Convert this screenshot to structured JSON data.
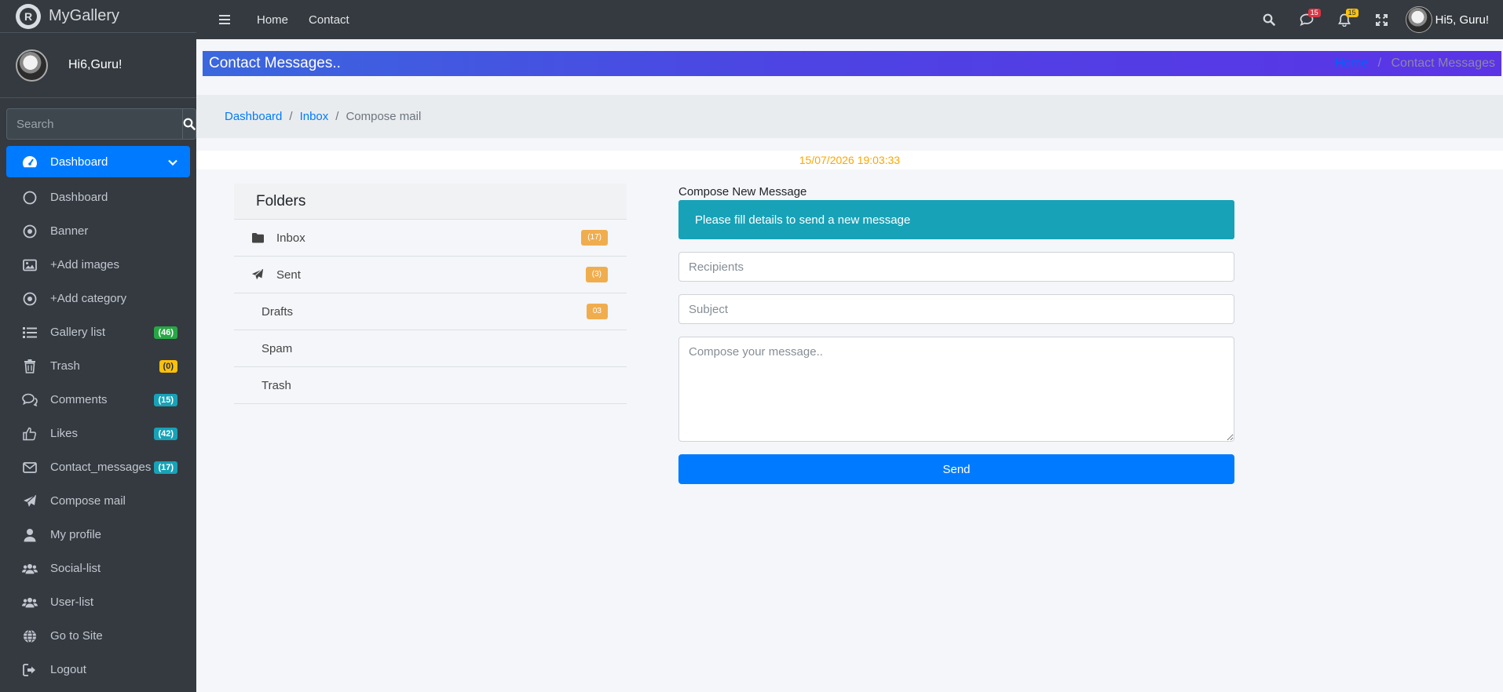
{
  "brand": {
    "name": "MyGallery"
  },
  "user_panel": {
    "name": "Hi6,Guru!"
  },
  "sidebar_search": {
    "placeholder": "Search"
  },
  "sidebar": {
    "items": [
      {
        "label": "Dashboard",
        "icon": "tachometer-icon",
        "active": true
      },
      {
        "label": "Dashboard",
        "icon": "circle-icon"
      },
      {
        "label": "Banner",
        "icon": "dot-circle-icon"
      },
      {
        "label": "+Add images",
        "icon": "image-icon"
      },
      {
        "label": "+Add category",
        "icon": "dot-circle-icon"
      },
      {
        "label": "Gallery list",
        "icon": "list-icon",
        "badge": "(46)",
        "badge_color": "#28a745"
      },
      {
        "label": "Trash",
        "icon": "trash-icon",
        "badge": "(0)",
        "badge_color": "#ffc107"
      },
      {
        "label": "Comments",
        "icon": "comments-icon",
        "badge": "(15)",
        "badge_color": "#17a2b8"
      },
      {
        "label": "Likes",
        "icon": "thumbs-up-icon",
        "badge": "(42)",
        "badge_color": "#17a2b8"
      },
      {
        "label": "Contact_messages",
        "icon": "envelope-icon",
        "badge": "(17)",
        "badge_color": "#17a2b8"
      },
      {
        "label": "Compose mail",
        "icon": "paper-plane-icon"
      },
      {
        "label": "My profile",
        "icon": "user-icon"
      },
      {
        "label": "Social-list",
        "icon": "users-icon"
      },
      {
        "label": "User-list",
        "icon": "users-icon"
      },
      {
        "label": "Go to Site",
        "icon": "globe-icon"
      },
      {
        "label": "Logout",
        "icon": "sign-out-icon"
      }
    ]
  },
  "topbar": {
    "links": [
      "Home",
      "Contact"
    ],
    "comments_badge": "15",
    "notifications_badge": "15",
    "user_greeting": "Hi5, Guru!"
  },
  "header": {
    "title": "Contact Messages..",
    "crumb_home": "Home",
    "crumb_current": "Contact Messages"
  },
  "breadcrumb": {
    "items": [
      "Dashboard",
      "Inbox"
    ],
    "current": "Compose mail"
  },
  "datetime": "15/07/2026 19:03:33",
  "folders": {
    "title": "Folders",
    "items": [
      {
        "label": "Inbox",
        "icon": "folder-icon",
        "badge": "(17)"
      },
      {
        "label": "Sent",
        "icon": "paper-plane-icon",
        "badge": "(3)"
      },
      {
        "label": "Drafts",
        "badge": "03"
      },
      {
        "label": "Spam"
      },
      {
        "label": "Trash"
      }
    ]
  },
  "compose": {
    "title": "Compose New Message",
    "alert": "Please fill details to send a new message",
    "recipients_placeholder": "Recipients",
    "subject_placeholder": "Subject",
    "message_placeholder": "Compose your message..",
    "send_label": "Send"
  },
  "colors": {
    "sidebar_bg": "#343a40",
    "primary": "#007bff",
    "info": "#17a2b8",
    "warning": "#f0ad4e",
    "date": "#ffa500"
  }
}
